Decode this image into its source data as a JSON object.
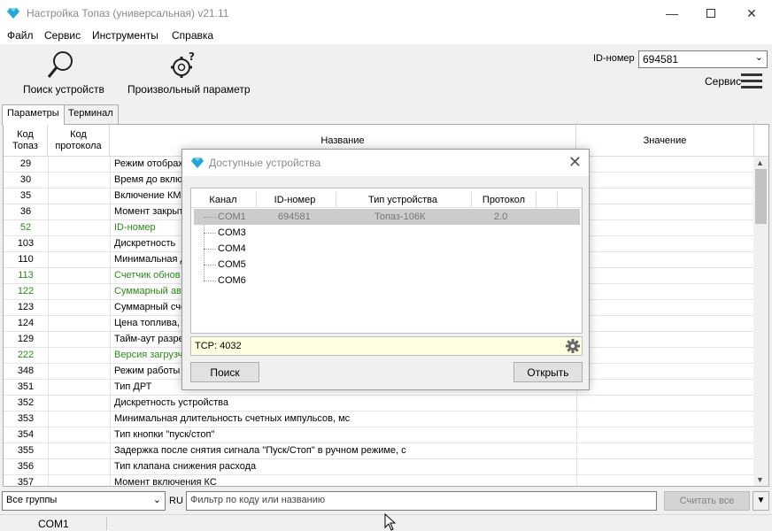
{
  "window": {
    "title": "Настройка Топаз (универсальная) v21.11"
  },
  "menu": [
    "Файл",
    "Сервис",
    "Инструменты",
    "Справка"
  ],
  "toolbar": {
    "search_devices_label": "Поиск устройств",
    "arbitrary_param_label": "Произвольный параметр",
    "id_label": "ID-номер",
    "id_value": "694581",
    "service_label": "Сервис"
  },
  "tabs": [
    "Параметры",
    "Терминал"
  ],
  "grid": {
    "headers": {
      "code_topaz": "Код Топаз",
      "code_protocol": "Код протокола",
      "name": "Название",
      "value": "Значение"
    },
    "rows": [
      {
        "code": "29",
        "name": "Режим отображ",
        "green": false
      },
      {
        "code": "30",
        "name": "Время до вклю",
        "green": false
      },
      {
        "code": "35",
        "name": "Включение КМ",
        "green": false
      },
      {
        "code": "36",
        "name": "Момент закрыт",
        "green": false
      },
      {
        "code": "52",
        "name": "ID-номер",
        "green": true
      },
      {
        "code": "103",
        "name": "Дискретность",
        "green": false
      },
      {
        "code": "110",
        "name": "Минимальная д",
        "green": false
      },
      {
        "code": "113",
        "name": "Счетчик обнов",
        "green": true
      },
      {
        "code": "122",
        "name": "Суммарный ава",
        "green": true
      },
      {
        "code": "123",
        "name": "Суммарный сче",
        "green": false
      },
      {
        "code": "124",
        "name": "Цена топлива,",
        "green": false
      },
      {
        "code": "129",
        "name": "Тайм-аут разре",
        "green": false
      },
      {
        "code": "222",
        "name": "Версия загрузч",
        "green": true
      },
      {
        "code": "348",
        "name": "Режим работы",
        "green": false
      },
      {
        "code": "351",
        "name": "Тип ДРТ",
        "green": false
      },
      {
        "code": "352",
        "name": "Дискретность устройства",
        "green": false
      },
      {
        "code": "353",
        "name": "Минимальная длительность счетных импульсов, мс",
        "green": false
      },
      {
        "code": "354",
        "name": "Тип кнопки \"пуск/стоп\"",
        "green": false
      },
      {
        "code": "355",
        "name": "Задержка после снятия сигнала \"Пуск/Стоп\" в ручном режиме, с",
        "green": false
      },
      {
        "code": "356",
        "name": "Тип клапана снижения расхода",
        "green": false
      },
      {
        "code": "357",
        "name": "Момент включения КС",
        "green": false
      }
    ]
  },
  "bottom": {
    "groups_value": "Все группы",
    "lang": "RU",
    "filter_placeholder": "Фильтр по коду или названию",
    "read_all_label": "Считать все"
  },
  "status": {
    "port": "COM1"
  },
  "dialog": {
    "title": "Доступные устройства",
    "columns": {
      "channel": "Канал",
      "id": "ID-номер",
      "device_type": "Тип устройства",
      "protocol": "Протокол"
    },
    "devices": [
      {
        "channel": "COM1",
        "id": "694581",
        "type": "Топаз-106К",
        "protocol": "2.0",
        "selected": true
      },
      {
        "channel": "COM3",
        "id": "",
        "type": "",
        "protocol": "",
        "selected": false
      },
      {
        "channel": "COM4",
        "id": "",
        "type": "",
        "protocol": "",
        "selected": false
      },
      {
        "channel": "COM5",
        "id": "",
        "type": "",
        "protocol": "",
        "selected": false
      },
      {
        "channel": "COM6",
        "id": "",
        "type": "",
        "protocol": "",
        "selected": false
      }
    ],
    "tcp": "TCP: 4032",
    "search_btn": "Поиск",
    "open_btn": "Открыть"
  },
  "colors": {
    "green_text": "#2a8a17",
    "app_icon": "#22a7d8"
  }
}
